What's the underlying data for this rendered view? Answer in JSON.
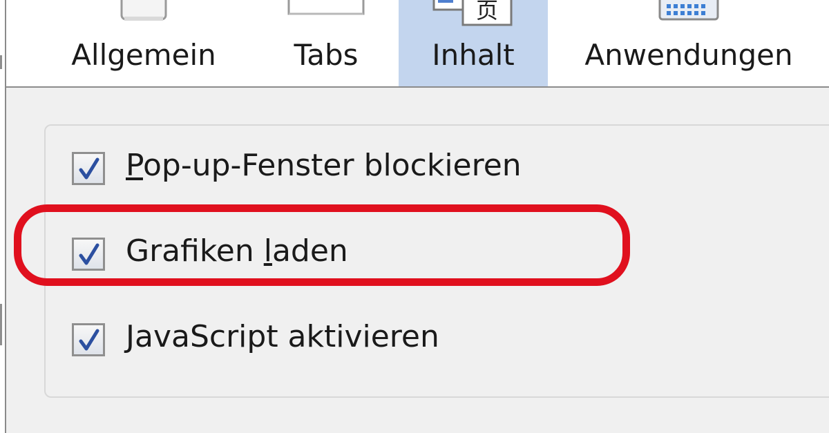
{
  "toolbar": {
    "tabs": [
      {
        "label": "Allgemein",
        "icon": "general-settings-icon",
        "selected": false
      },
      {
        "label": "Tabs",
        "icon": "tabs-icon",
        "selected": false
      },
      {
        "label": "Inhalt",
        "icon": "content-icon",
        "selected": true
      },
      {
        "label": "Anwendungen",
        "icon": "applications-icon",
        "selected": false
      }
    ],
    "content_icon_glyph": "页"
  },
  "content_options": [
    {
      "label": "Pop-up-Fenster blockieren",
      "checked": true,
      "access_key": "P"
    },
    {
      "label": "Grafiken laden",
      "checked": true,
      "access_key": "l",
      "highlighted": true
    },
    {
      "label": "JavaScript aktivieren",
      "checked": true,
      "access_key": "J"
    }
  ],
  "colors": {
    "selected_tab": "#c3d5ee",
    "highlight_ring": "#e0101e",
    "checkmark": "#2b4fa0"
  }
}
